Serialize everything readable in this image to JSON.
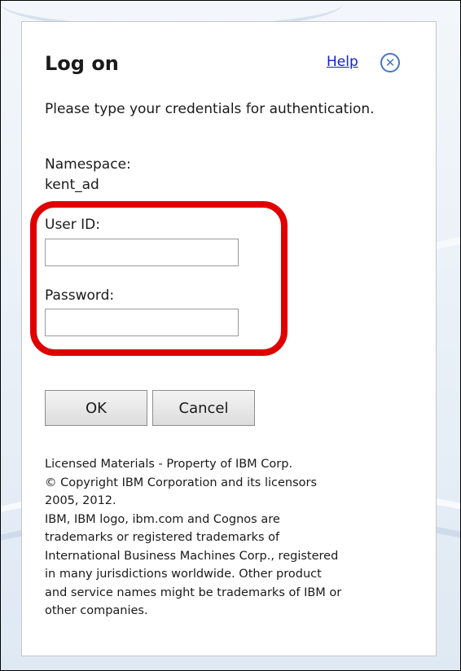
{
  "dialog": {
    "title": "Log on",
    "help_label": "Help",
    "close_icon": "close-circle-icon",
    "instructions": "Please type your credentials for authentication.",
    "namespace_label": "Namespace:",
    "namespace_value": "kent_ad",
    "user_id_label": "User ID:",
    "user_id_value": "",
    "password_label": "Password:",
    "password_value": "",
    "ok_label": "OK",
    "cancel_label": "Cancel",
    "legal_lines": [
      "Licensed Materials - Property of IBM Corp.",
      "© Copyright IBM Corporation and its licensors",
      "2005, 2012.",
      "IBM, IBM logo, ibm.com and Cognos are",
      "trademarks or registered trademarks of",
      "International Business Machines Corp., registered",
      "in many jurisdictions worldwide. Other product",
      "and service names might be trademarks of IBM or",
      "other companies."
    ]
  },
  "colors": {
    "highlight": "#e00000",
    "link": "#1122cc",
    "close_icon": "#4a76c4"
  }
}
